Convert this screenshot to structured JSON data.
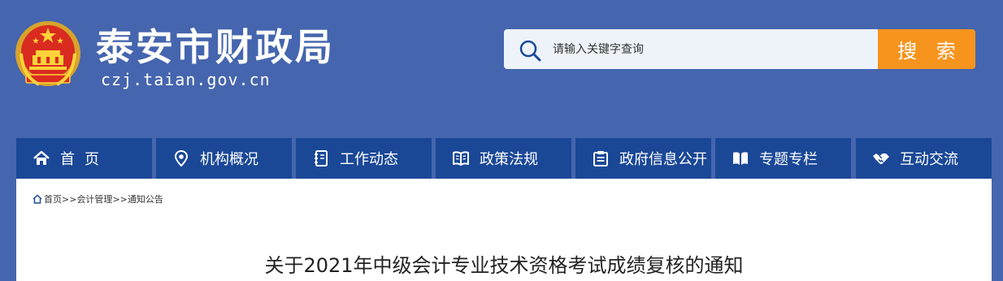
{
  "header": {
    "site_title": "泰安市财政局",
    "site_domain": "czj.taian.gov.cn",
    "logo_icon": "national-emblem-icon"
  },
  "search": {
    "placeholder": "请输入关键字查询",
    "button_label": "搜 索",
    "icon": "search-icon"
  },
  "nav": {
    "items": [
      {
        "label": "首页",
        "icon": "home-icon"
      },
      {
        "label": "机构概况",
        "icon": "location-pin-icon"
      },
      {
        "label": "工作动态",
        "icon": "notebook-icon"
      },
      {
        "label": "政策法规",
        "icon": "open-book-icon"
      },
      {
        "label": "政府信息公开",
        "icon": "clipboard-icon"
      },
      {
        "label": "专题专栏",
        "icon": "book-icon"
      },
      {
        "label": "互动交流",
        "icon": "handshake-icon"
      }
    ]
  },
  "breadcrumb": {
    "home": "首页",
    "sep1": ">>",
    "level1": "会计管理",
    "sep2": ">>",
    "level2": "通知公告"
  },
  "article": {
    "title": "关于2021年中级会计专业技术资格考试成绩复核的通知"
  },
  "colors": {
    "page_background": "#4565ae",
    "nav_background": "#1a4897",
    "search_button": "#f7941e",
    "search_box": "#eef3fa"
  }
}
